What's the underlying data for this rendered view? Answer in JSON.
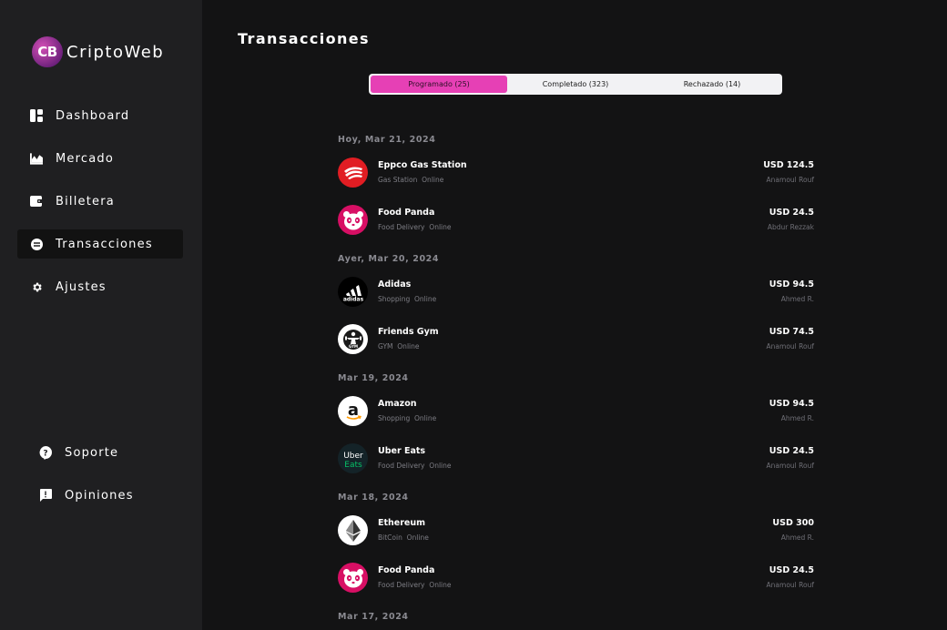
{
  "app": {
    "logo_badge": "CB",
    "logo_name": "CriptoWeb"
  },
  "sidebar": {
    "items": [
      {
        "label": "Dashboard",
        "icon": "dashboard-icon"
      },
      {
        "label": "Mercado",
        "icon": "chart-area-icon"
      },
      {
        "label": "Billetera",
        "icon": "wallet-icon"
      },
      {
        "label": "Transacciones",
        "icon": "transactions-icon",
        "active": true
      },
      {
        "label": "Ajustes",
        "icon": "gear-icon"
      }
    ],
    "bottom_items": [
      {
        "label": "Soporte",
        "icon": "support-icon"
      },
      {
        "label": "Opiniones",
        "icon": "feedback-icon"
      }
    ]
  },
  "main": {
    "title": "Transacciones",
    "tabs": [
      {
        "label": "Programado (25)",
        "active": true
      },
      {
        "label": "Completado (323)"
      },
      {
        "label": "Rechazado (14)"
      }
    ],
    "accent_color": "#e640b5",
    "groups": [
      {
        "date": "Hoy, Mar 21, 2024",
        "transactions": [
          {
            "name": "Eppco Gas Station",
            "category": "Gas Station",
            "channel": "Online",
            "amount": "USD 124.5",
            "user": "Anamoul Rouf",
            "logo": "eppco-logo"
          },
          {
            "name": "Food Panda",
            "category": "Food Delivery",
            "channel": "Online",
            "amount": "USD 24.5",
            "user": "Abdur Rezzak",
            "logo": "foodpanda-logo"
          }
        ]
      },
      {
        "date": "Ayer, Mar 20, 2024",
        "transactions": [
          {
            "name": "Adidas",
            "category": "Shopping",
            "channel": "Online",
            "amount": "USD 94.5",
            "user": "Ahmed R.",
            "logo": "adidas-logo",
            "logo_text": "adidas"
          },
          {
            "name": "Friends Gym",
            "category": "GYM",
            "channel": "Online",
            "amount": "USD 74.5",
            "user": "Anamoul Rouf",
            "logo": "gym-logo",
            "logo_text": "GYM"
          }
        ]
      },
      {
        "date": "Mar 19, 2024",
        "transactions": [
          {
            "name": "Amazon",
            "category": "Shopping",
            "channel": "Online",
            "amount": "USD 94.5",
            "user": "Ahmed R.",
            "logo": "amazon-logo",
            "logo_text": "a"
          },
          {
            "name": "Uber Eats",
            "category": "Food Delivery",
            "channel": "Online",
            "amount": "USD 24.5",
            "user": "Anamoul Rouf",
            "logo": "ubereats-logo",
            "logo_text": "Uber",
            "logo_text2": "Eats"
          }
        ]
      },
      {
        "date": "Mar 18, 2024",
        "transactions": [
          {
            "name": "Ethereum",
            "category": "BitCoin",
            "channel": "Online",
            "amount": "USD 300",
            "user": "Ahmed R.",
            "logo": "ethereum-logo"
          },
          {
            "name": "Food Panda",
            "category": "Food Delivery",
            "channel": "Online",
            "amount": "USD 24.5",
            "user": "Anamoul Rouf",
            "logo": "foodpanda-logo"
          }
        ]
      },
      {
        "date": "Mar 17, 2024",
        "transactions": []
      }
    ]
  }
}
